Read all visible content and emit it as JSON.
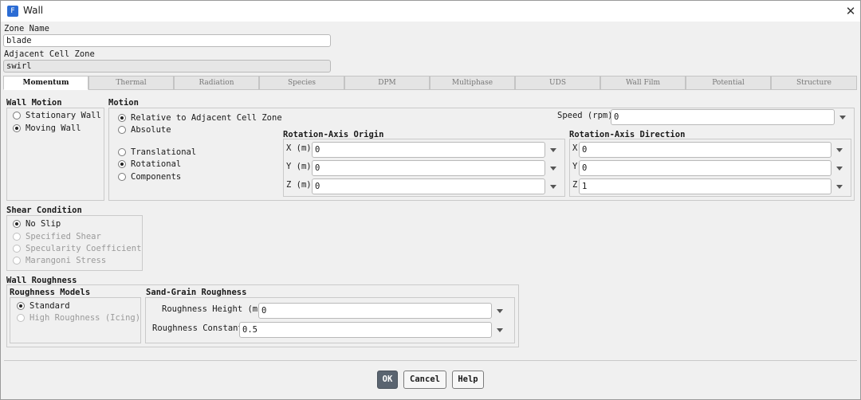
{
  "window": {
    "title": "Wall",
    "icon_glyph": "F"
  },
  "zone": {
    "name_label": "Zone Name",
    "name_value": "blade",
    "adjacent_label": "Adjacent Cell Zone",
    "adjacent_value": "swirl"
  },
  "tabs": [
    "Momentum",
    "Thermal",
    "Radiation",
    "Species",
    "DPM",
    "Multiphase",
    "UDS",
    "Wall Film",
    "Potential",
    "Structure"
  ],
  "wall_motion": {
    "title": "Wall Motion",
    "options": [
      "Stationary Wall",
      "Moving Wall"
    ],
    "selected": "Moving Wall"
  },
  "motion": {
    "title": "Motion",
    "frame_options": [
      "Relative to Adjacent Cell Zone",
      "Absolute"
    ],
    "frame_selected": "Relative to Adjacent Cell Zone",
    "type_options": [
      "Translational",
      "Rotational",
      "Components"
    ],
    "type_selected": "Rotational",
    "speed_label": "Speed (rpm)",
    "speed_value": "0",
    "origin": {
      "title": "Rotation-Axis Origin",
      "x_label": "X (m)",
      "x": "0",
      "y_label": "Y (m)",
      "y": "0",
      "z_label": "Z (m)",
      "z": "0"
    },
    "direction": {
      "title": "Rotation-Axis Direction",
      "x_label": "X",
      "x": "0",
      "y_label": "Y",
      "y": "0",
      "z_label": "Z",
      "z": "1"
    }
  },
  "shear": {
    "title": "Shear Condition",
    "options": [
      "No Slip",
      "Specified Shear",
      "Specularity Coefficient",
      "Marangoni Stress"
    ],
    "selected": "No Slip"
  },
  "roughness": {
    "title": "Wall Roughness",
    "models_title": "Roughness Models",
    "models": [
      "Standard",
      "High Roughness (Icing)"
    ],
    "model_selected": "Standard",
    "sand_title": "Sand-Grain Roughness",
    "height_label": "Roughness Height (m)",
    "height_value": "0",
    "constant_label": "Roughness Constant",
    "constant_value": "0.5"
  },
  "buttons": {
    "ok": "OK",
    "cancel": "Cancel",
    "help": "Help"
  }
}
